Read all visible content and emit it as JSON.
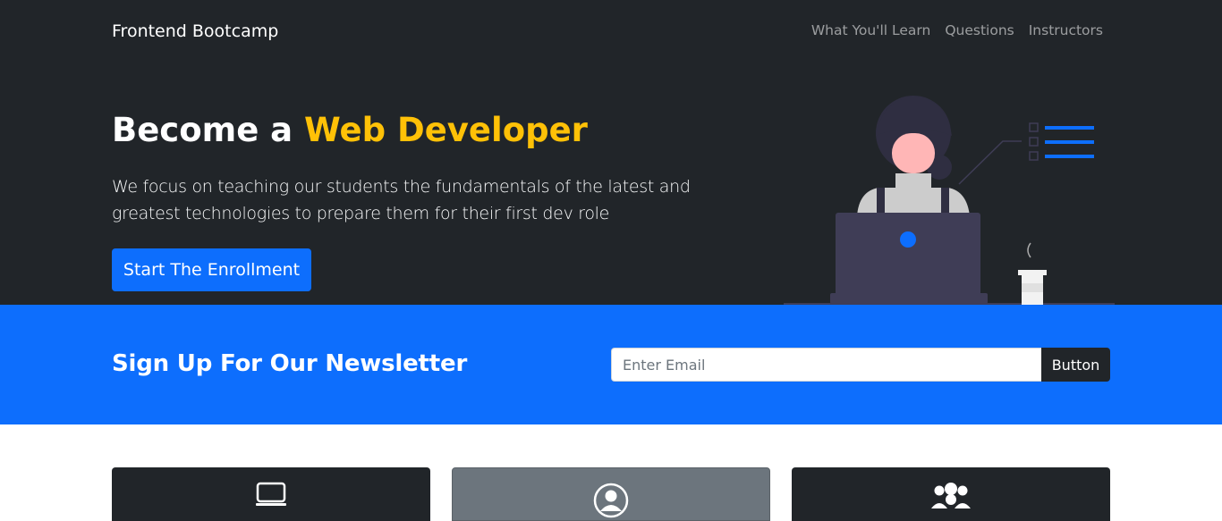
{
  "navbar": {
    "brand": "Frontend Bootcamp",
    "links": [
      "What You'll Learn",
      "Questions",
      "Instructors"
    ]
  },
  "hero": {
    "title_prefix": "Become a ",
    "title_highlight": "Web Developer",
    "description": "We focus on teaching our students the fundamentals of the latest and greatest technologies to prepare them for their first dev role",
    "cta_label": "Start The Enrollment"
  },
  "newsletter": {
    "title": "Sign Up For Our Newsletter",
    "email_placeholder": "Enter Email",
    "button_label": "Button"
  },
  "cards": [
    {
      "icon": "laptop-icon"
    },
    {
      "icon": "person-circle-icon"
    },
    {
      "icon": "people-icon"
    }
  ],
  "colors": {
    "dark": "#212529",
    "primary": "#0d6efd",
    "warning": "#ffc107",
    "secondary": "#6c757d"
  }
}
